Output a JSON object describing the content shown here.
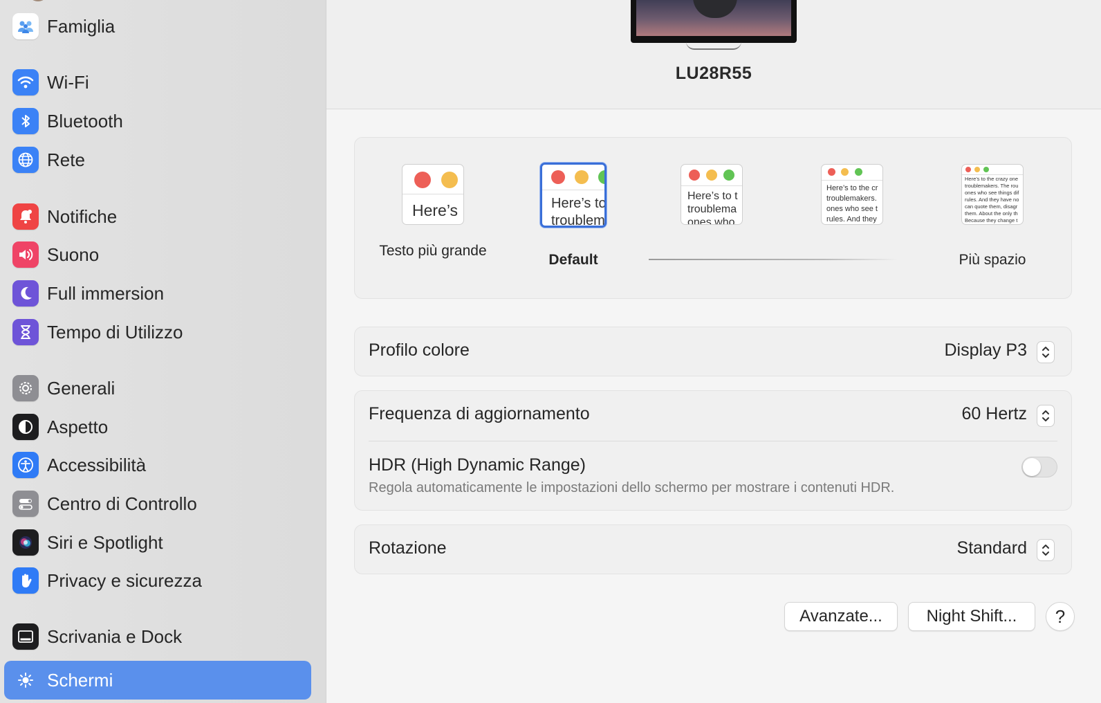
{
  "colors": {
    "accent": "#3a6fd8",
    "sidebar_active": "#5a90ec",
    "traffic_red": "#ed5f57",
    "traffic_yellow": "#f4bd4f",
    "traffic_green": "#61c454"
  },
  "sidebar": {
    "items": [
      {
        "label": "Famiglia",
        "icon": "family-icon",
        "color": "#ffffff"
      },
      {
        "label": "Wi-Fi",
        "icon": "wifi-icon",
        "color": "#3b82f6"
      },
      {
        "label": "Bluetooth",
        "icon": "bluetooth-icon",
        "color": "#3b82f6"
      },
      {
        "label": "Rete",
        "icon": "globe-icon",
        "color": "#3b82f6"
      },
      {
        "label": "Notifiche",
        "icon": "bell-icon",
        "color": "#ef4444"
      },
      {
        "label": "Suono",
        "icon": "speaker-icon",
        "color": "#ef4466"
      },
      {
        "label": "Full immersion",
        "icon": "moon-icon",
        "color": "#6e54d8"
      },
      {
        "label": "Tempo di Utilizzo",
        "icon": "hourglass-icon",
        "color": "#6e54d8"
      },
      {
        "label": "Generali",
        "icon": "gear-icon",
        "color": "#8e8e93"
      },
      {
        "label": "Aspetto",
        "icon": "appearance-icon",
        "color": "#1d1d1f"
      },
      {
        "label": "Accessibilità",
        "icon": "accessibility-icon",
        "color": "#2f7bf6"
      },
      {
        "label": "Centro di Controllo",
        "icon": "control-center-icon",
        "color": "#8e8e93"
      },
      {
        "label": "Siri e Spotlight",
        "icon": "siri-icon",
        "color": "#1d1d1f"
      },
      {
        "label": "Privacy e sicurezza",
        "icon": "hand-icon",
        "color": "#2f7bf6"
      },
      {
        "label": "Scrivania e Dock",
        "icon": "dock-icon",
        "color": "#1d1d1f"
      },
      {
        "label": "Schermi",
        "icon": "brightness-icon",
        "color": "#3b82f6",
        "active": true
      }
    ]
  },
  "display": {
    "name": "LU28R55"
  },
  "resolution": {
    "options": [
      {
        "label": "Testo più grande",
        "preview": "Here’s"
      },
      {
        "label": "Default",
        "preview": "Here’s to\ntroublem",
        "selected": true
      },
      {
        "label": "",
        "preview": "Here’s to t\ntroublema\nones who"
      },
      {
        "label": "",
        "preview": "Here’s to the cr\ntroublemakers.\nones who see t\nrules. And they"
      },
      {
        "label": "Più spazio",
        "preview": "Here’s to the crazy one\ntroublemakers. The rou\nones who see things dif\nrules. And they have no\ncan quote them, disagr\nthem. About the only th\nBecause they change t"
      }
    ]
  },
  "settings": {
    "color_profile": {
      "label": "Profilo colore",
      "value": "Display P3"
    },
    "refresh_rate": {
      "label": "Frequenza di aggiornamento",
      "value": "60 Hertz"
    },
    "hdr": {
      "label": "HDR (High Dynamic Range)",
      "description": "Regola automaticamente le impostazioni dello schermo per mostrare i contenuti HDR.",
      "enabled": false
    },
    "rotation": {
      "label": "Rotazione",
      "value": "Standard"
    }
  },
  "buttons": {
    "advanced": "Avanzate...",
    "night_shift": "Night Shift...",
    "help": "?"
  }
}
